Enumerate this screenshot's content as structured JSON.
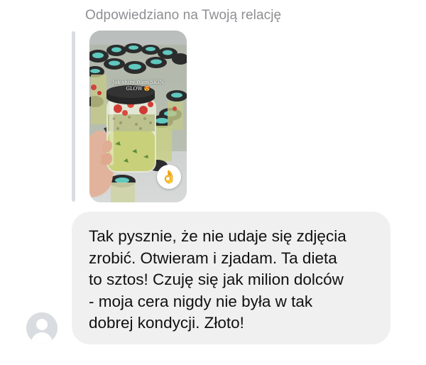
{
  "reply_header": "Odpowiedziano na Twoją relację",
  "story": {
    "caption_line1": "Jak służy Wam SKIN",
    "caption_line2": "GLOW",
    "caption_emoji": "😍",
    "reaction": "👌"
  },
  "avatar": "avatar-placeholder",
  "message": {
    "text": "Tak pysznie, że nie udaje się zdjęcia\nzrobić. Otwieram i zjadam. Ta dieta\nto sztos! Czuję się jak milion dolców\n- moja cera nigdy nie była w tak\ndobrej kondycji. Złoto!"
  },
  "colors": {
    "bubble_bg": "#f0f0f0",
    "header_text": "#8e8e93",
    "quote_bar": "#dadde1",
    "jar_lid": "#2c2c2c",
    "lid_label": "#5fc8bf"
  }
}
